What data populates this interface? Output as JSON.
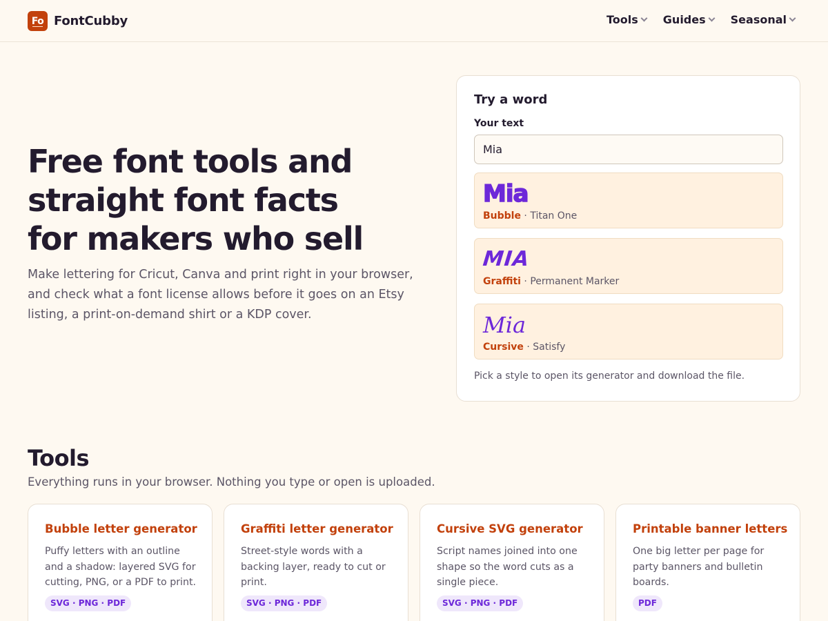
{
  "header": {
    "logo_mark": "Fo",
    "brand": "FontCubby",
    "nav": [
      {
        "label": "Tools"
      },
      {
        "label": "Guides"
      },
      {
        "label": "Seasonal"
      }
    ]
  },
  "hero": {
    "title_lines": [
      "Free font tools and",
      "straight font facts",
      "for makers who sell"
    ],
    "subtitle": "Make lettering for Cricut, Canva and print right in your browser, and check what a font license allows before it goes on an Etsy listing, a print-on-demand shirt or a KDP cover."
  },
  "try_card": {
    "title": "Try a word",
    "input_label": "Your text",
    "input_value": "Mia",
    "styles": [
      {
        "preview": "Mia",
        "name": "Bubble",
        "separator": " · ",
        "font": "Titan One"
      },
      {
        "preview": "MIA",
        "name": "Graffiti",
        "separator": " · ",
        "font": "Permanent Marker"
      },
      {
        "preview": "Mia",
        "name": "Cursive",
        "separator": " · ",
        "font": "Satisfy"
      }
    ],
    "note": "Pick a style to open its generator and download the file."
  },
  "tools": {
    "title": "Tools",
    "subtitle": "Everything runs in your browser. Nothing you type or open is uploaded.",
    "cards": [
      {
        "name": "Bubble letter generator",
        "description": "Puffy letters with an outline and a shadow: layered SVG for cutting, PNG, or a PDF to print.",
        "formats": "SVG · PNG · PDF"
      },
      {
        "name": "Graffiti letter generator",
        "description": "Street-style words with a backing layer, ready to cut or print.",
        "formats": "SVG · PNG · PDF"
      },
      {
        "name": "Cursive SVG generator",
        "description": "Script names joined into one shape so the word cuts as a single piece.",
        "formats": "SVG · PNG · PDF"
      },
      {
        "name": "Printable banner letters",
        "description": "One big letter per page for party banners and bulletin boards.",
        "formats": "PDF"
      }
    ]
  },
  "colors": {
    "accent": "#c2410c",
    "preview_purple": "#6d28d9",
    "background": "#fef9f1"
  }
}
